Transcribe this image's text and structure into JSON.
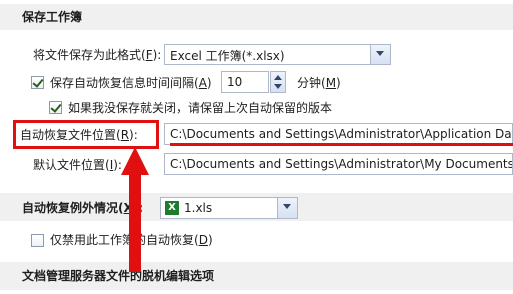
{
  "section_save": {
    "title": "保存工作簿"
  },
  "format_row": {
    "label": "将文件保存为此格式(",
    "accel": "F",
    "label_end": "):",
    "value": "Excel 工作簿(*.xlsx)"
  },
  "autosave_row": {
    "label": "保存自动恢复信息时间间隔(",
    "accel": "A",
    "label_end": ")",
    "value": "10",
    "unit": "分钟(",
    "unit_accel": "M",
    "unit_end": ")"
  },
  "keep_row": {
    "label": "如果我没保存就关闭，请保留上次自动保留的版本"
  },
  "recover_row": {
    "label": "自动恢复文件位置(",
    "accel": "R",
    "label_end": "):",
    "value": "C:\\Documents and Settings\\Administrator\\Application Data"
  },
  "default_row": {
    "label": "默认文件位置(",
    "accel": "I",
    "label_end": "):",
    "value": "C:\\Documents and Settings\\Administrator\\My Documents"
  },
  "section_except": {
    "label": "自动恢复例外情况(",
    "accel": "X",
    "label_end": "):",
    "value": "1.xls",
    "icon_glyph": "X"
  },
  "disable_row": {
    "label": "仅禁用此工作簿的自动恢复(",
    "accel": "D",
    "label_end": ")"
  },
  "section_offline": {
    "title": "文档管理服务器文件的脱机编辑选项"
  },
  "annotation_color": "#e01010",
  "icons": [
    "chevron-down-icon",
    "checkmark-icon",
    "spin-up-icon",
    "spin-down-icon",
    "excel-file-icon",
    "red-arrow-annotation"
  ]
}
